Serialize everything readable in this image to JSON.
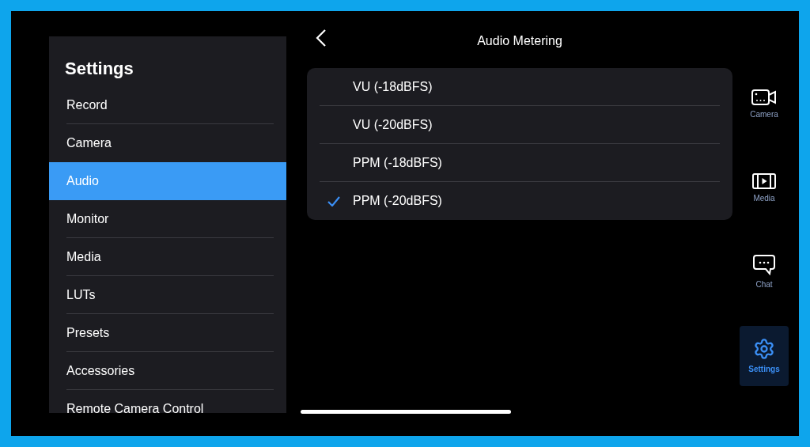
{
  "sidebar": {
    "title": "Settings",
    "items": [
      {
        "label": "Record",
        "selected": false
      },
      {
        "label": "Camera",
        "selected": false
      },
      {
        "label": "Audio",
        "selected": true
      },
      {
        "label": "Monitor",
        "selected": false
      },
      {
        "label": "Media",
        "selected": false
      },
      {
        "label": "LUTs",
        "selected": false
      },
      {
        "label": "Presets",
        "selected": false
      },
      {
        "label": "Accessories",
        "selected": false
      },
      {
        "label": "Remote Camera Control",
        "selected": false
      }
    ]
  },
  "detail": {
    "title": "Audio Metering",
    "options": [
      {
        "label": "VU (-18dBFS)",
        "selected": false
      },
      {
        "label": "VU (-20dBFS)",
        "selected": false
      },
      {
        "label": "PPM (-18dBFS)",
        "selected": false
      },
      {
        "label": "PPM (-20dBFS)",
        "selected": true
      }
    ]
  },
  "rail": [
    {
      "kind": "camera",
      "label": "Camera",
      "selected": false
    },
    {
      "kind": "media",
      "label": "Media",
      "selected": false
    },
    {
      "kind": "chat",
      "label": "Chat",
      "selected": false
    },
    {
      "kind": "settings",
      "label": "Settings",
      "selected": true
    }
  ]
}
